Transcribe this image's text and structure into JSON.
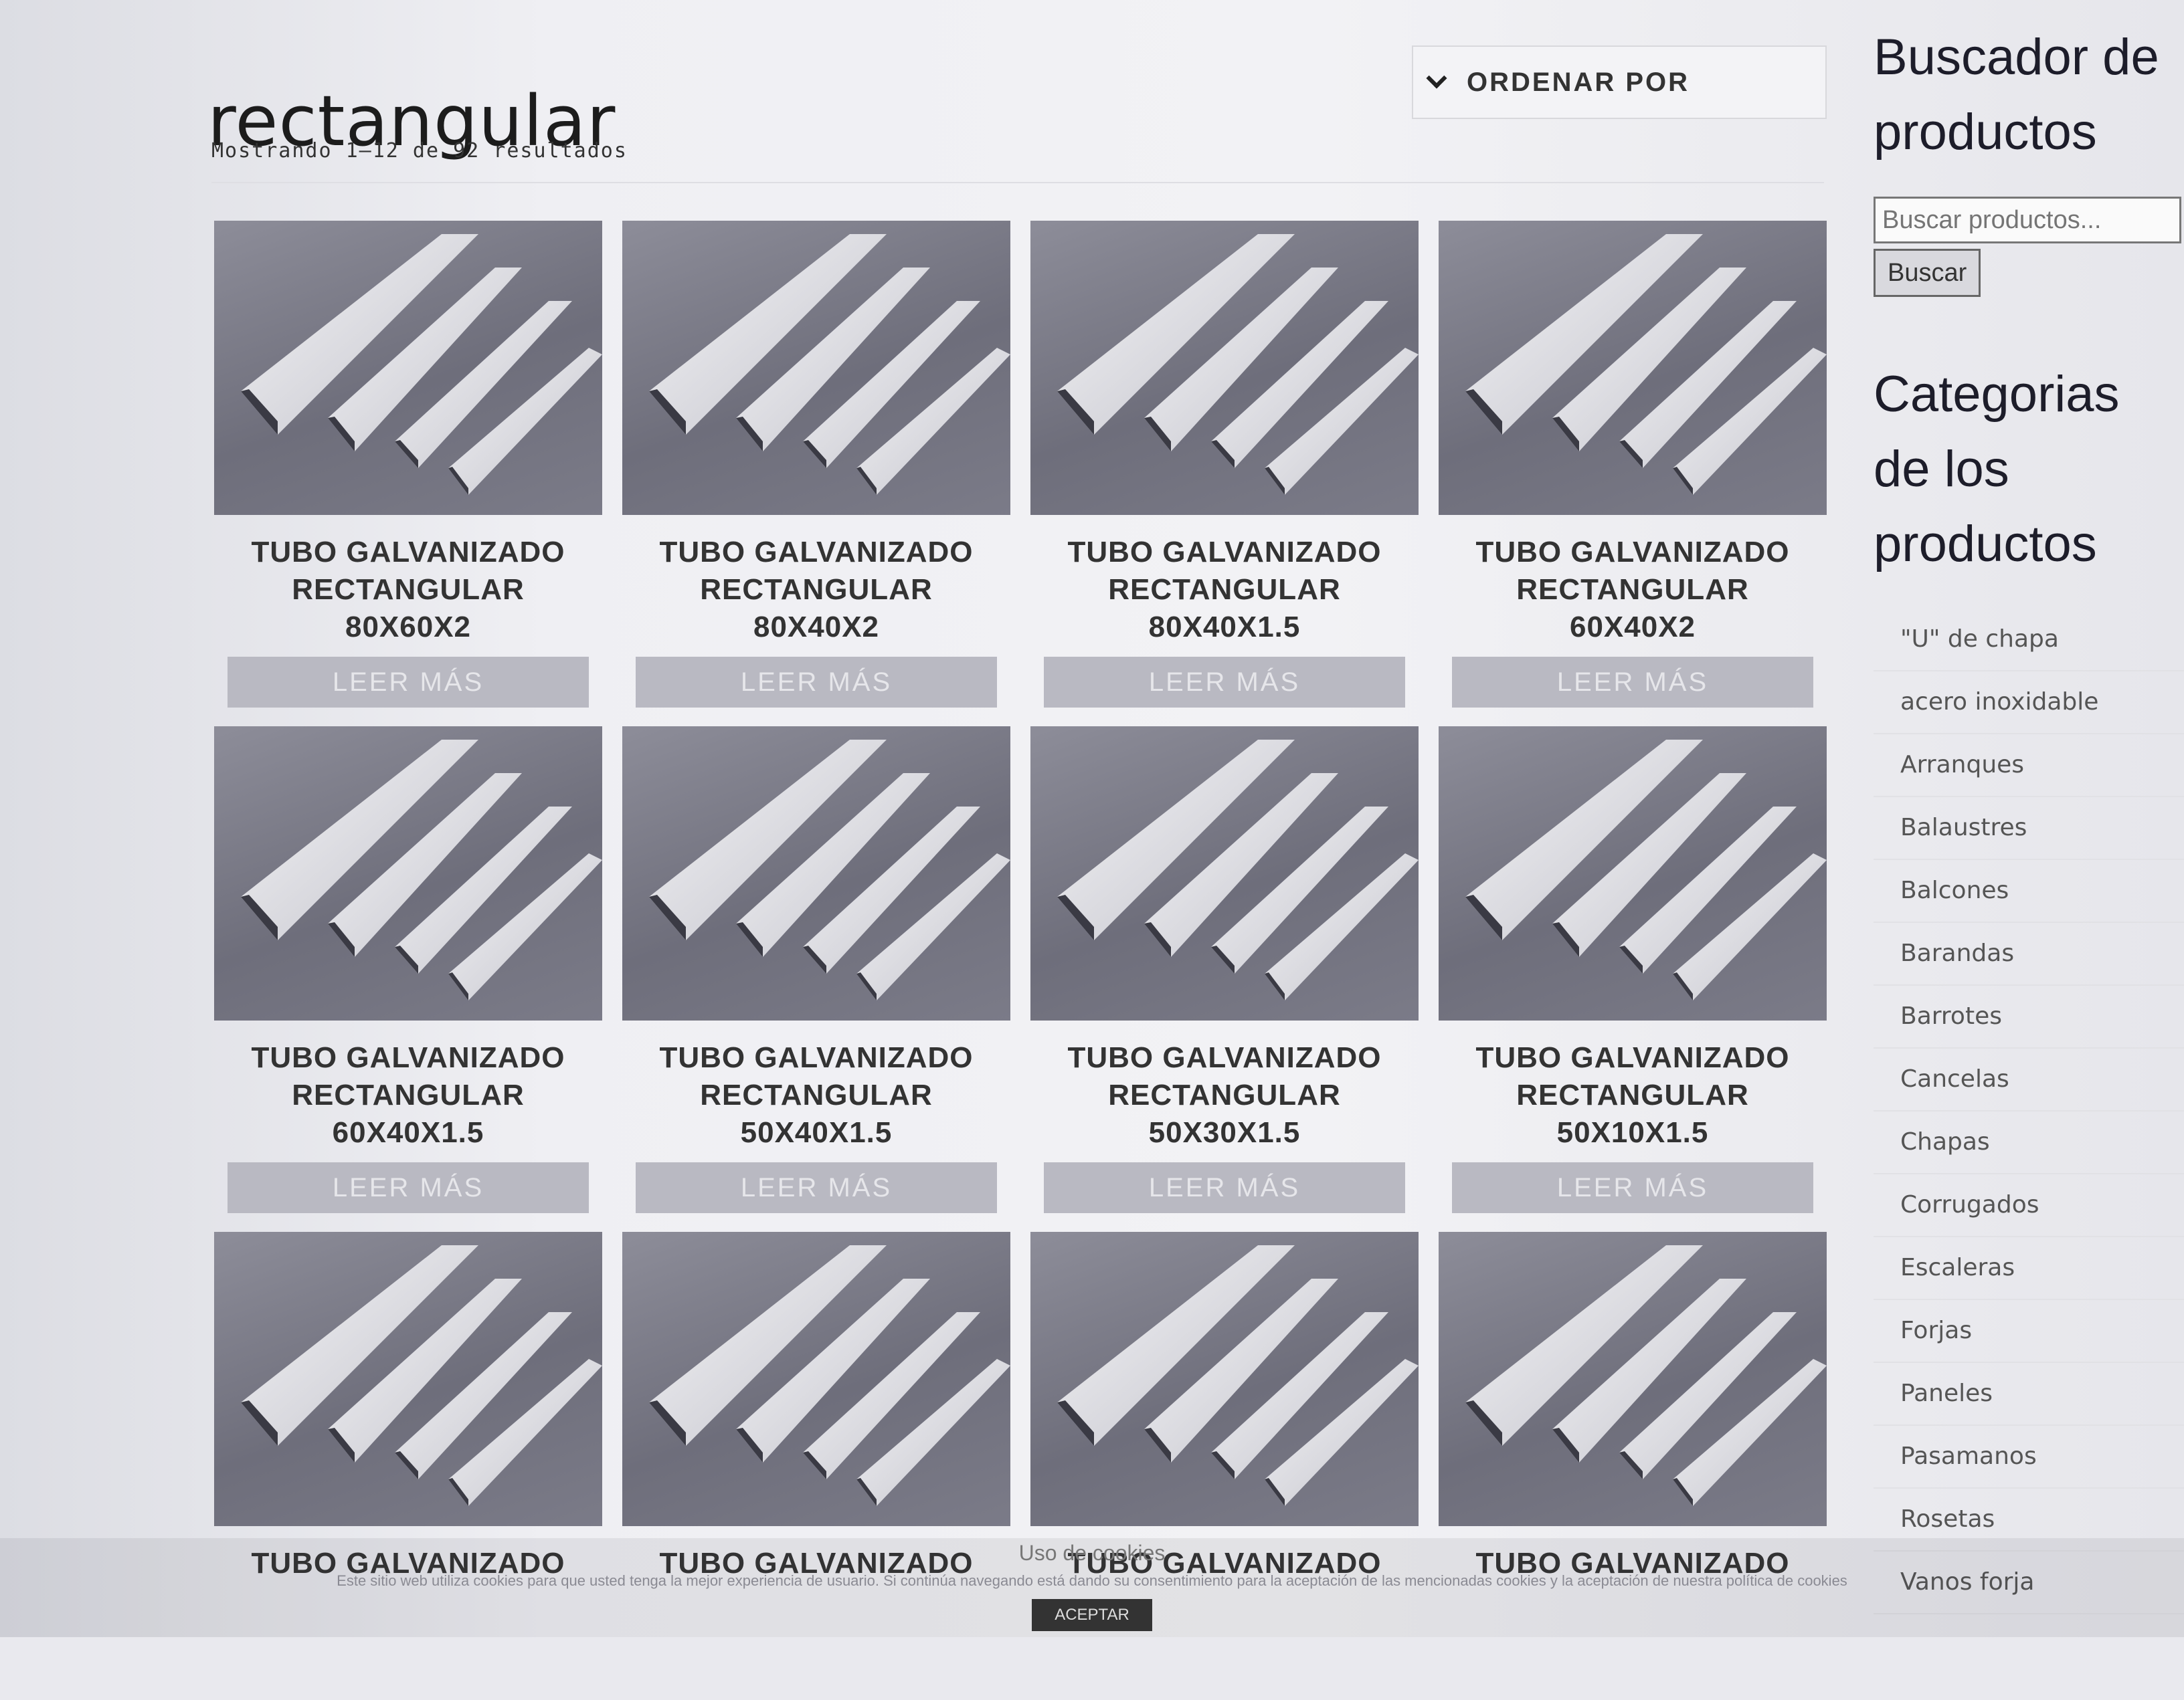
{
  "header": {
    "title": "rectangular",
    "result_count": "Mostrando 1–12 de 92 resultados",
    "order_label": "ORDENAR POR"
  },
  "products": [
    {
      "line1": "TUBO GALVANIZADO",
      "line2": "RECTANGULAR",
      "line3": "80X60X2",
      "button": "LEER MÁS"
    },
    {
      "line1": "TUBO GALVANIZADO",
      "line2": "RECTANGULAR",
      "line3": "80X40X2",
      "button": "LEER MÁS"
    },
    {
      "line1": "TUBO GALVANIZADO",
      "line2": "RECTANGULAR",
      "line3": "80X40X1.5",
      "button": "LEER MÁS"
    },
    {
      "line1": "TUBO GALVANIZADO",
      "line2": "RECTANGULAR",
      "line3": "60X40X2",
      "button": "LEER MÁS"
    },
    {
      "line1": "TUBO GALVANIZADO",
      "line2": "RECTANGULAR",
      "line3": "60X40X1.5",
      "button": "LEER MÁS"
    },
    {
      "line1": "TUBO GALVANIZADO",
      "line2": "RECTANGULAR",
      "line3": "50X40X1.5",
      "button": "LEER MÁS"
    },
    {
      "line1": "TUBO GALVANIZADO",
      "line2": "RECTANGULAR",
      "line3": "50X30X1.5",
      "button": "LEER MÁS"
    },
    {
      "line1": "TUBO GALVANIZADO",
      "line2": "RECTANGULAR",
      "line3": "50X10X1.5",
      "button": "LEER MÁS"
    },
    {
      "line1": "TUBO GALVANIZADO",
      "line2": "",
      "line3": "",
      "button": ""
    },
    {
      "line1": "TUBO GALVANIZADO",
      "line2": "",
      "line3": "",
      "button": ""
    },
    {
      "line1": "TUBO GALVANIZADO",
      "line2": "",
      "line3": "",
      "button": ""
    },
    {
      "line1": "TUBO GALVANIZADO",
      "line2": "",
      "line3": "",
      "button": ""
    }
  ],
  "sidebar": {
    "search_title": "Buscador de productos",
    "search_placeholder": "Buscar productos...",
    "search_button": "Buscar",
    "categories_title": "Categorias de los productos",
    "categories": [
      "\"U\" de chapa",
      "acero inoxidable",
      "Arranques",
      "Balaustres",
      "Balcones",
      "Barandas",
      "Barrotes",
      "Cancelas",
      "Chapas",
      "Corrugados",
      "Escaleras",
      "Forjas",
      "Paneles",
      "Pasamanos",
      "Rosetas",
      "Vanos forja"
    ]
  },
  "cookies": {
    "title": "Uso de cookies",
    "text": "Este sitio web utiliza cookies para que usted tenga la mejor experiencia de usuario. Si continúa navegando está dando su consentimiento para la aceptación de las mencionadas cookies y la aceptación de nuestra política de cookies",
    "accept": "ACEPTAR"
  },
  "colors": {
    "button_bg": "#b9b9c2",
    "image_bg": "#7b7b88"
  }
}
